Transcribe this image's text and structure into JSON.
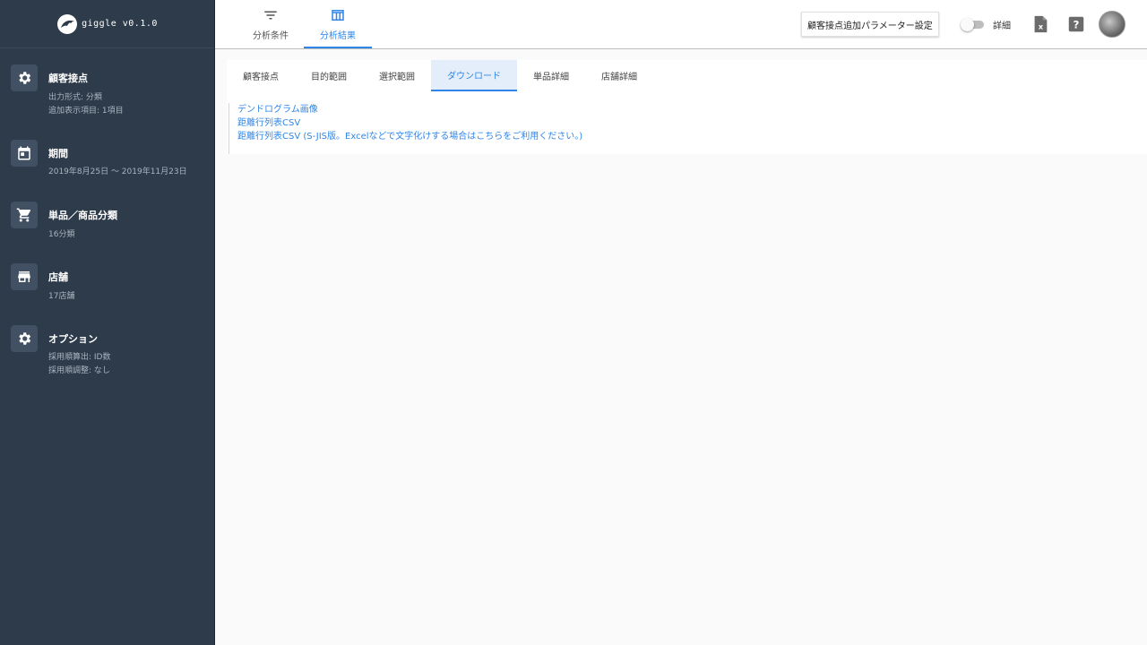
{
  "app": {
    "name": "giggle v0.1.0"
  },
  "header": {
    "tabs": [
      {
        "label": "分析条件",
        "icon": "filter-icon"
      },
      {
        "label": "分析結果",
        "icon": "table-icon"
      }
    ],
    "param_button": "顧客接点追加パラメーター設定",
    "toggle_label": "詳細"
  },
  "sidebar": {
    "items": [
      {
        "title": "顧客接点",
        "icon": "gear-icon",
        "lines": [
          "出力形式: 分類",
          "追加表示項目: 1項目"
        ]
      },
      {
        "title": "期間",
        "icon": "calendar-icon",
        "lines": [
          "2019年8月25日 〜 2019年11月23日"
        ]
      },
      {
        "title": "単品／商品分類",
        "icon": "cart-icon",
        "lines": [
          "16分類"
        ]
      },
      {
        "title": "店舗",
        "icon": "store-icon",
        "lines": [
          "17店舗"
        ]
      },
      {
        "title": "オプション",
        "icon": "gear-icon",
        "lines": [
          "採用順算出: ID数",
          "採用順調整: なし"
        ]
      }
    ]
  },
  "content": {
    "subtabs": [
      "顧客接点",
      "目的範囲",
      "選択範囲",
      "ダウンロード",
      "単品詳細",
      "店舗詳細"
    ],
    "active_subtab": "ダウンロード",
    "links": [
      "デンドログラム画像",
      "距離行列表CSV",
      "距離行列表CSV (S-JIS版。Excelなどで文字化けする場合はこちらをご利用ください。)"
    ]
  },
  "colors": {
    "sidebar": "#2e3b4a",
    "accent": "#2f86e8"
  }
}
